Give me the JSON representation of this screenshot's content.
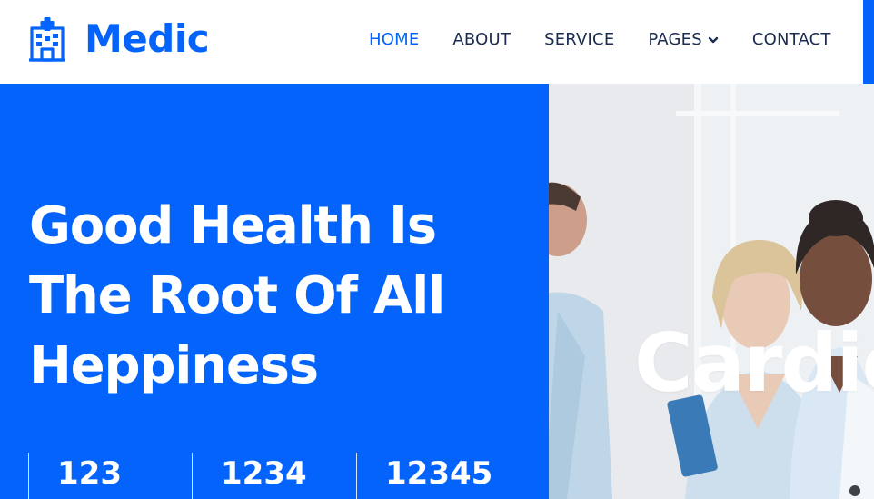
{
  "brand": {
    "name": "Medic",
    "icon": "hospital-icon",
    "color": "#0463fa"
  },
  "nav": {
    "items": [
      {
        "label": "HOME",
        "active": true
      },
      {
        "label": "ABOUT",
        "active": false
      },
      {
        "label": "SERVICE",
        "active": false
      },
      {
        "label": "PAGES",
        "active": false,
        "dropdown": true,
        "icon": "chevron-down-icon"
      },
      {
        "label": "CONTACT",
        "active": false
      }
    ]
  },
  "hero": {
    "title_lines": [
      "Good Health Is",
      "The Root Of All",
      "Heppiness"
    ],
    "background_color": "#0463fa",
    "stats": [
      {
        "value": "123"
      },
      {
        "value": "1234"
      },
      {
        "value": "12345"
      }
    ]
  },
  "carousel": {
    "caption": "Cardio"
  },
  "colors": {
    "primary": "#0463fa",
    "dark": "#1b2c51",
    "white": "#ffffff"
  }
}
